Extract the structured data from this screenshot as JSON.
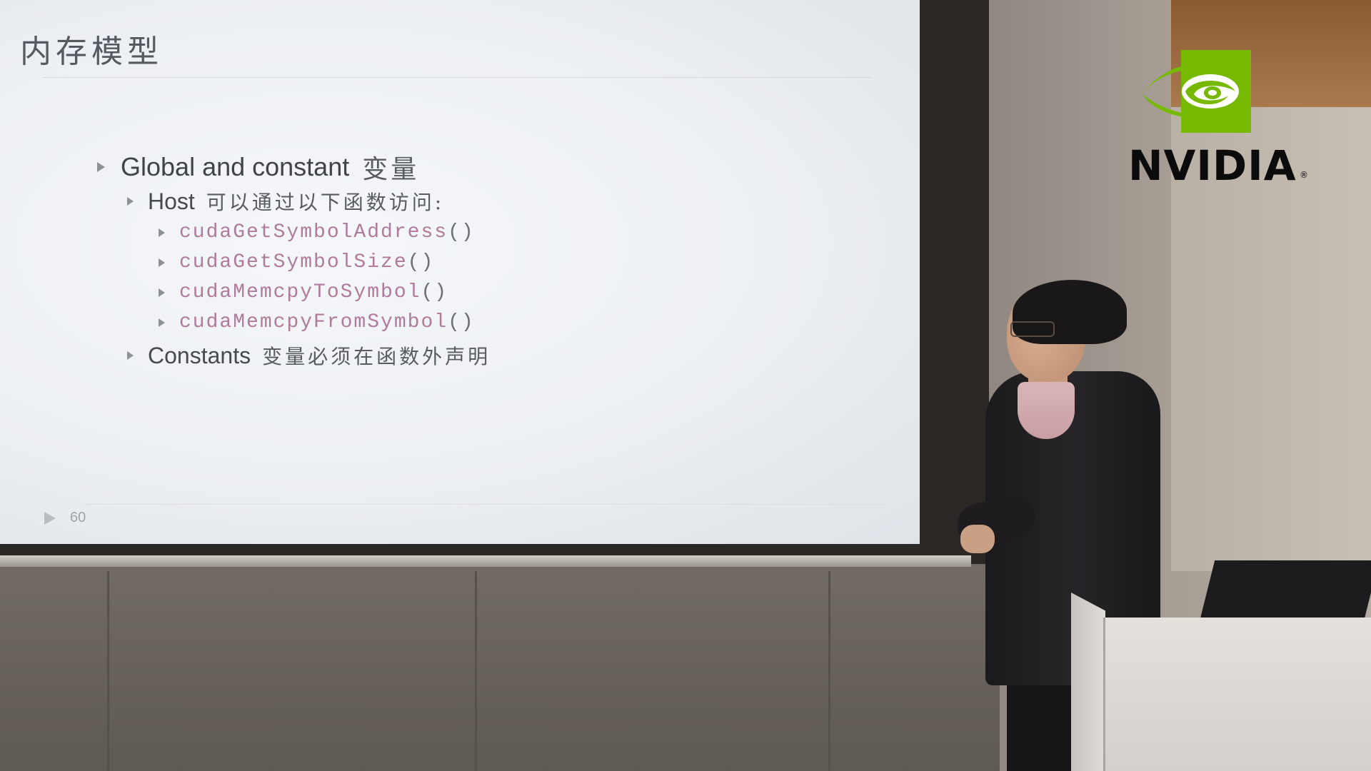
{
  "slide": {
    "title": "内存模型",
    "bullets": [
      {
        "text_latin": "Global and constant",
        "text_cjk": "变量",
        "children": [
          {
            "text_latin": "Host",
            "text_cjk": "可以通过以下函数访问:",
            "code_items": [
              {
                "name": "cudaGetSymbolAddress",
                "parens": "()"
              },
              {
                "name": "cudaGetSymbolSize",
                "parens": "()"
              },
              {
                "name": "cudaMemcpyToSymbol",
                "parens": "()"
              },
              {
                "name": "cudaMemcpyFromSymbol",
                "parens": "()"
              }
            ]
          },
          {
            "text_latin": "Constants",
            "text_cjk": "变量必须在函数外声明"
          }
        ]
      }
    ],
    "page_number": "60"
  },
  "logo": {
    "wordmark": "NVIDIA",
    "registered": "®",
    "brand_color": "#76b900"
  },
  "colors": {
    "slide_bg": "#eef1f4",
    "code_text": "#b07a9a",
    "bullet_marker": "#8d9297"
  }
}
